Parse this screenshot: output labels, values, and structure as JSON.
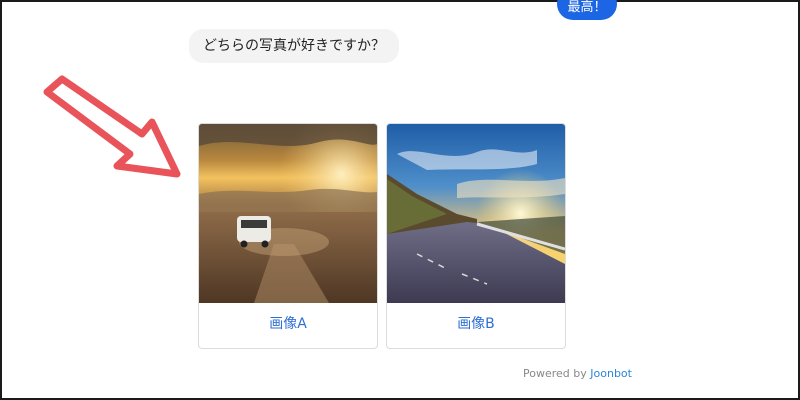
{
  "chat": {
    "user_message": "最高！",
    "bot_question": "どちらの写真が好きですか？"
  },
  "choices": [
    {
      "label": "画像A",
      "photo": "desert-road-van-sunset"
    },
    {
      "label": "画像B",
      "photo": "coastal-mountain-road-sunset"
    }
  ],
  "footer": {
    "powered_prefix": "Powered by",
    "brand": "Joonbot"
  },
  "colors": {
    "user_bubble": "#1c66e5",
    "arrow": "#e8545a",
    "label": "#2f6fd4",
    "brand": "#2b86d9"
  },
  "icons": {
    "pointer": "arrow-icon"
  }
}
